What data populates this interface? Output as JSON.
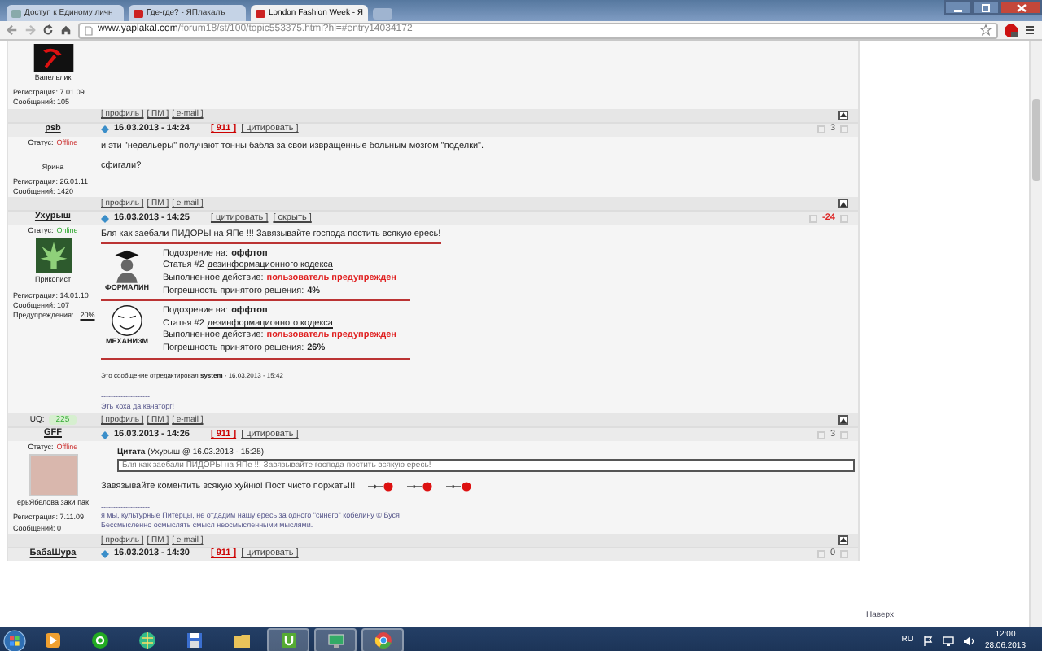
{
  "browser": {
    "tabs": [
      {
        "title": "Доступ к Единому личн",
        "selected": false
      },
      {
        "title": "Где-где? - ЯПлакалъ",
        "selected": false
      },
      {
        "title": "London Fashion Week - Я",
        "selected": true
      }
    ],
    "address": {
      "host": "www.yaplakal.com",
      "path": "/forum18/st/100/topic553375.html?hl=#entry14034172"
    }
  },
  "posts": [
    {
      "user": {
        "avatar": {
          "kind": "logo"
        },
        "rank": "Вапельлик",
        "registered": "Регистрация: 7.01.09",
        "messages": "Сообщений: 105"
      },
      "footer_links": [
        "[ профиль ]",
        "[ ПМ ]",
        "[ e-mail ]"
      ]
    },
    {
      "author": "psb",
      "date": "16.03.2013 - 14:24",
      "header_links": [
        {
          "text": "[ 911 ]",
          "kind": "count"
        },
        {
          "text": "[ цитировать ]",
          "kind": "link"
        }
      ],
      "rating": "3",
      "rating_negative": false,
      "user": {
        "status_label": "Статус:",
        "status": "Offline",
        "online": false,
        "rank": "Ярина",
        "registered": "Регистрация: 26.01.11",
        "messages": "Сообщений: 1420"
      },
      "body": [
        {
          "kind": "text",
          "text": "и эти \"недельеры\" получают тонны бабла за свои извращенные больным мозгом \"поделки\"."
        },
        {
          "kind": "text",
          "text": "сфигали?"
        }
      ],
      "footer_links": [
        "[ профиль ]",
        "[ ПМ ]",
        "[ e-mail ]"
      ]
    },
    {
      "author": "Ухурыш",
      "date": "16.03.2013 - 14:25",
      "header_links": [
        {
          "text": "[ цитировать ]",
          "kind": "link"
        },
        {
          "text": "[ скрыть ]",
          "kind": "link"
        }
      ],
      "rating": "-24",
      "rating_negative": true,
      "user": {
        "avatar": {
          "kind": "leaf"
        },
        "status_label": "Статус:",
        "status": "Online",
        "online": true,
        "rank": "Прикопист",
        "registered": "Регистрация: 14.01.10",
        "messages": "Сообщений: 107",
        "warnings_label": "Предупреждения:",
        "warnings": "20%"
      },
      "body": [
        {
          "kind": "headline",
          "text": "Бля как заебали ПИДОРЫ на ЯПе !!! Завязывайте господа постить всякую ересь!"
        },
        {
          "kind": "moderation",
          "figure": {
            "kind": "graduate"
          },
          "caption": "ФОРМАЛИН",
          "lines": [
            {
              "label": "Подозрение на:",
              "value": "оффтоп",
              "kind": "bold"
            },
            {
              "label": "Статья #2",
              "value": "дезинформационного кодекса",
              "kind": "link"
            },
            {
              "label": "Выполненное действие:",
              "value": "пользователь предупрежден",
              "kind": "alert"
            },
            {
              "label": "Погрешность принятого решения:",
              "value": "4%",
              "kind": "bold"
            }
          ]
        },
        {
          "kind": "moderation",
          "figure": {
            "kind": "face"
          },
          "caption": "МЕХАНИЗМ",
          "lines": [
            {
              "label": "Подозрение на:",
              "value": "оффтоп",
              "kind": "bold"
            },
            {
              "label": "Статья #2",
              "value": "дезинформационного кодекса",
              "kind": "link"
            },
            {
              "label": "Выполненное действие:",
              "value": "пользователь предупрежден",
              "kind": "alert"
            },
            {
              "label": "Погрешность принятого решения:",
              "value": "26%",
              "kind": "bold"
            }
          ]
        },
        {
          "kind": "edit_note",
          "text": "Это сообщение отредактировал **system** - 16.03.2013 - 15:42"
        },
        {
          "kind": "signature",
          "separator": "--------------------",
          "lines": [
            "Эть хоха да качаторг!"
          ]
        }
      ],
      "uq": {
        "label": "UQ:",
        "value": "225"
      },
      "footer_links": [
        "[ профиль ]",
        "[ ПМ ]",
        "[ e-mail ]"
      ]
    },
    {
      "author": "GFF",
      "date": "16.03.2013 - 14:26",
      "header_links": [
        {
          "text": "[ 911 ]",
          "kind": "count"
        },
        {
          "text": "[ цитировать ]",
          "kind": "link"
        }
      ],
      "rating": "3",
      "rating_negative": false,
      "user": {
        "avatar": {
          "kind": "photo"
        },
        "status_label": "Статус:",
        "status": "Offline",
        "online": false,
        "rank": "ерьЯбелова заки пак",
        "registered": "Регистрация: 7.11.09",
        "messages": "Сообщений: 0"
      },
      "body": [
        {
          "kind": "quote",
          "title": "**Цитата** (Ухурыш @ 16.03.2013 - 15:25)",
          "text": "Бля как заебали ПИДОРЫ на ЯПе !!! Завязывайте господа постить всякую ересь!"
        },
        {
          "kind": "text_emoticons",
          "text": "Завязывайте коментить всякую хуйню! Пост чисто поржать!!!",
          "emoticons": [
            {
              "kind": "rose"
            },
            {
              "kind": "rose"
            },
            {
              "kind": "rose"
            }
          ]
        },
        {
          "kind": "signature",
          "separator": "--------------------",
          "lines": [
            "я мы, культурные Питерцы, не отдадим нашу ересь за одного \"синего\" кобелину © Буся",
            "Бессмысленно осмыслять смысл неосмысленными мыслями."
          ]
        }
      ],
      "footer_links": [
        "[ профиль ]",
        "[ ПМ ]",
        "[ e-mail ]"
      ]
    },
    {
      "author": "БабаШура",
      "date": "16.03.2013 - 14:30",
      "header_links": [
        {
          "text": "[ 911 ]",
          "kind": "count"
        },
        {
          "text": "[ цитировать ]",
          "kind": "link"
        }
      ],
      "rating": "0",
      "rating_negative": false
    }
  ],
  "back_to_top": "Наверх",
  "taskbar": {
    "apps": [
      {
        "kind": "media",
        "open": false
      },
      {
        "kind": "mail",
        "open": false
      },
      {
        "kind": "globe",
        "open": false
      },
      {
        "kind": "floppy",
        "open": false
      },
      {
        "kind": "folder",
        "open": false
      },
      {
        "kind": "torrent",
        "open": true
      },
      {
        "kind": "monitor",
        "open": true
      },
      {
        "kind": "chrome",
        "open": true
      }
    ],
    "language": "RU",
    "time": "12:00",
    "date": "28.06.2013"
  }
}
